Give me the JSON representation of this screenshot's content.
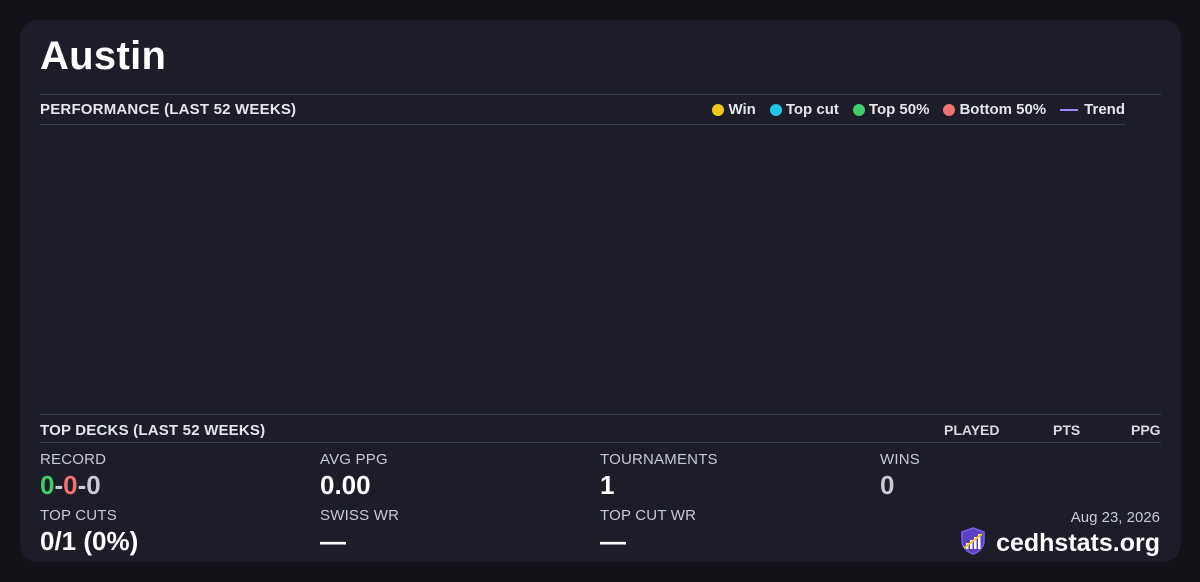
{
  "player": {
    "name": "Austin"
  },
  "performance": {
    "label": "PERFORMANCE (LAST 52 WEEKS)",
    "legend": [
      {
        "label": "Win",
        "color": "#f5c518",
        "kind": "dot"
      },
      {
        "label": "Top cut",
        "color": "#22c7e8",
        "kind": "dot"
      },
      {
        "label": "Top 50%",
        "color": "#3ecf6a",
        "kind": "dot"
      },
      {
        "label": "Bottom 50%",
        "color": "#f07272",
        "kind": "dot"
      },
      {
        "label": "Trend",
        "color": "#9b8cf4",
        "kind": "line"
      }
    ]
  },
  "top_decks": {
    "label": "TOP DECKS (LAST 52 WEEKS)",
    "columns": [
      "PLAYED",
      "PTS",
      "PPG"
    ]
  },
  "stats": {
    "record_label": "RECORD",
    "record": {
      "wins": "0",
      "losses": "0",
      "draws": "0",
      "sep": "-"
    },
    "avg_ppg_label": "AVG PPG",
    "avg_ppg": "0.00",
    "tournaments_label": "TOURNAMENTS",
    "tournaments": "1",
    "wins_label": "WINS",
    "wins": "0",
    "top_cuts_label": "TOP CUTS",
    "top_cuts": "0/1 (0%)",
    "swiss_wr_label": "SWISS WR",
    "swiss_wr": "—",
    "top_cut_wr_label": "TOP CUT WR",
    "top_cut_wr": "—"
  },
  "footer": {
    "date": "Aug 23, 2026",
    "brand": "cedhstats.org",
    "brand_icon": "shield-chart-icon"
  },
  "colors": {
    "record_win": "#3ecf6a",
    "record_loss": "#f07272",
    "record_draw": "#c8c9d2",
    "wins_value": "#c8c9d2"
  }
}
